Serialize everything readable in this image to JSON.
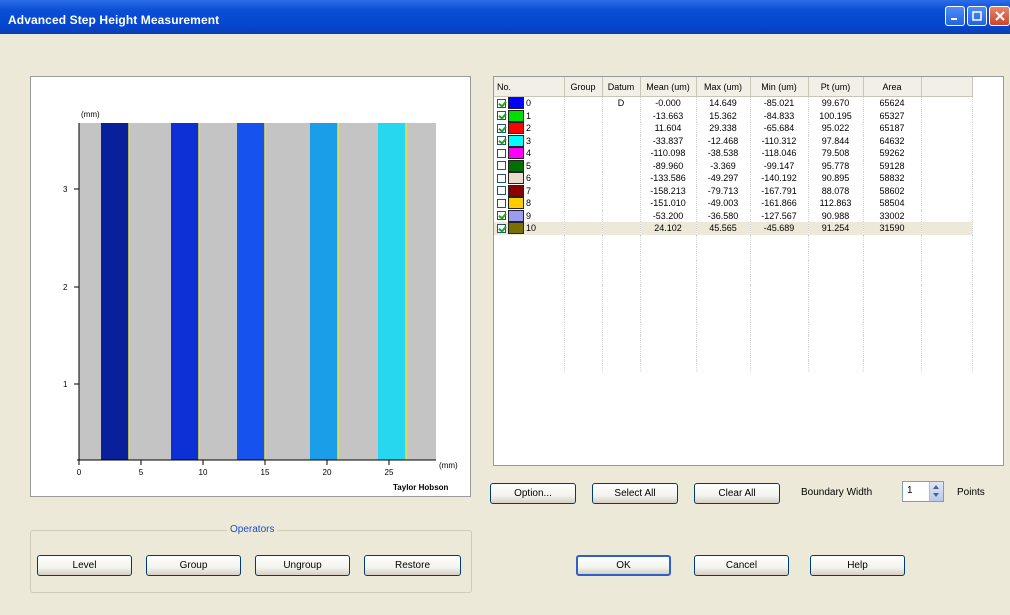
{
  "window": {
    "title": "Advanced Step Height Measurement"
  },
  "plot": {
    "y_unit": "(mm)",
    "x_unit": "(mm)",
    "x_ticks": [
      "0",
      "5",
      "10",
      "15",
      "20",
      "25"
    ],
    "y_ticks": [
      "3",
      "2",
      "1"
    ],
    "brand": "Taylor Hobson",
    "band_colors": [
      "#0a1f9c",
      "#0c2fd6",
      "#1552ee",
      "#1a9ee8",
      "#27d6ef"
    ],
    "background_color": "#c4c4c4"
  },
  "table": {
    "columns": [
      "No.",
      "Group",
      "Datum",
      "Mean (um)",
      "Max (um)",
      "Min (um)",
      "Pt (um)",
      "Area"
    ],
    "rows": [
      {
        "checked": true,
        "color": "#0000ff",
        "no": "0",
        "group": "",
        "datum": "D",
        "mean": "-0.000",
        "max": "14.649",
        "min": "-85.021",
        "pt": "99.670",
        "area": "65624"
      },
      {
        "checked": true,
        "color": "#00e000",
        "no": "1",
        "group": "",
        "datum": "",
        "mean": "-13.663",
        "max": "15.362",
        "min": "-84.833",
        "pt": "100.195",
        "area": "65327"
      },
      {
        "checked": true,
        "color": "#ff0000",
        "no": "2",
        "group": "",
        "datum": "",
        "mean": "11.604",
        "max": "29.338",
        "min": "-65.684",
        "pt": "95.022",
        "area": "65187"
      },
      {
        "checked": true,
        "color": "#00ffff",
        "no": "3",
        "group": "",
        "datum": "",
        "mean": "-33.837",
        "max": "-12.468",
        "min": "-110.312",
        "pt": "97.844",
        "area": "64632"
      },
      {
        "checked": false,
        "color": "#ff00ff",
        "no": "4",
        "group": "",
        "datum": "",
        "mean": "-110.098",
        "max": "-38.538",
        "min": "-118.046",
        "pt": "79.508",
        "area": "59262"
      },
      {
        "checked": false,
        "color": "#007000",
        "no": "5",
        "group": "",
        "datum": "",
        "mean": "-89.960",
        "max": "-3.369",
        "min": "-99.147",
        "pt": "95.778",
        "area": "59128"
      },
      {
        "checked": false,
        "color": "#e8dccb",
        "no": "6",
        "group": "",
        "datum": "",
        "mean": "-133.586",
        "max": "-49.297",
        "min": "-140.192",
        "pt": "90.895",
        "area": "58832"
      },
      {
        "checked": false,
        "color": "#8b0000",
        "no": "7",
        "group": "",
        "datum": "",
        "mean": "-158.213",
        "max": "-79.713",
        "min": "-167.791",
        "pt": "88.078",
        "area": "58602"
      },
      {
        "checked": false,
        "color": "#ffcc00",
        "no": "8",
        "group": "",
        "datum": "",
        "mean": "-151.010",
        "max": "-49.003",
        "min": "-161.866",
        "pt": "112.863",
        "area": "58504"
      },
      {
        "checked": true,
        "color": "#9a9cf0",
        "no": "9",
        "group": "",
        "datum": "",
        "mean": "-53.200",
        "max": "-36.580",
        "min": "-127.567",
        "pt": "90.988",
        "area": "33002"
      },
      {
        "checked": true,
        "color": "#7a7000",
        "no": "10",
        "group": "",
        "datum": "",
        "mean": "24.102",
        "max": "45.565",
        "min": "-45.689",
        "pt": "91.254",
        "area": "31590"
      }
    ]
  },
  "buttons": {
    "option": "Option...",
    "select_all": "Select All",
    "clear_all": "Clear All",
    "ok": "OK",
    "cancel": "Cancel",
    "help": "Help",
    "level": "Level",
    "group": "Group",
    "ungroup": "Ungroup",
    "restore": "Restore"
  },
  "boundary": {
    "label": "Boundary Width",
    "value": "1",
    "unit": "Points"
  },
  "operators": {
    "legend": "Operators"
  }
}
